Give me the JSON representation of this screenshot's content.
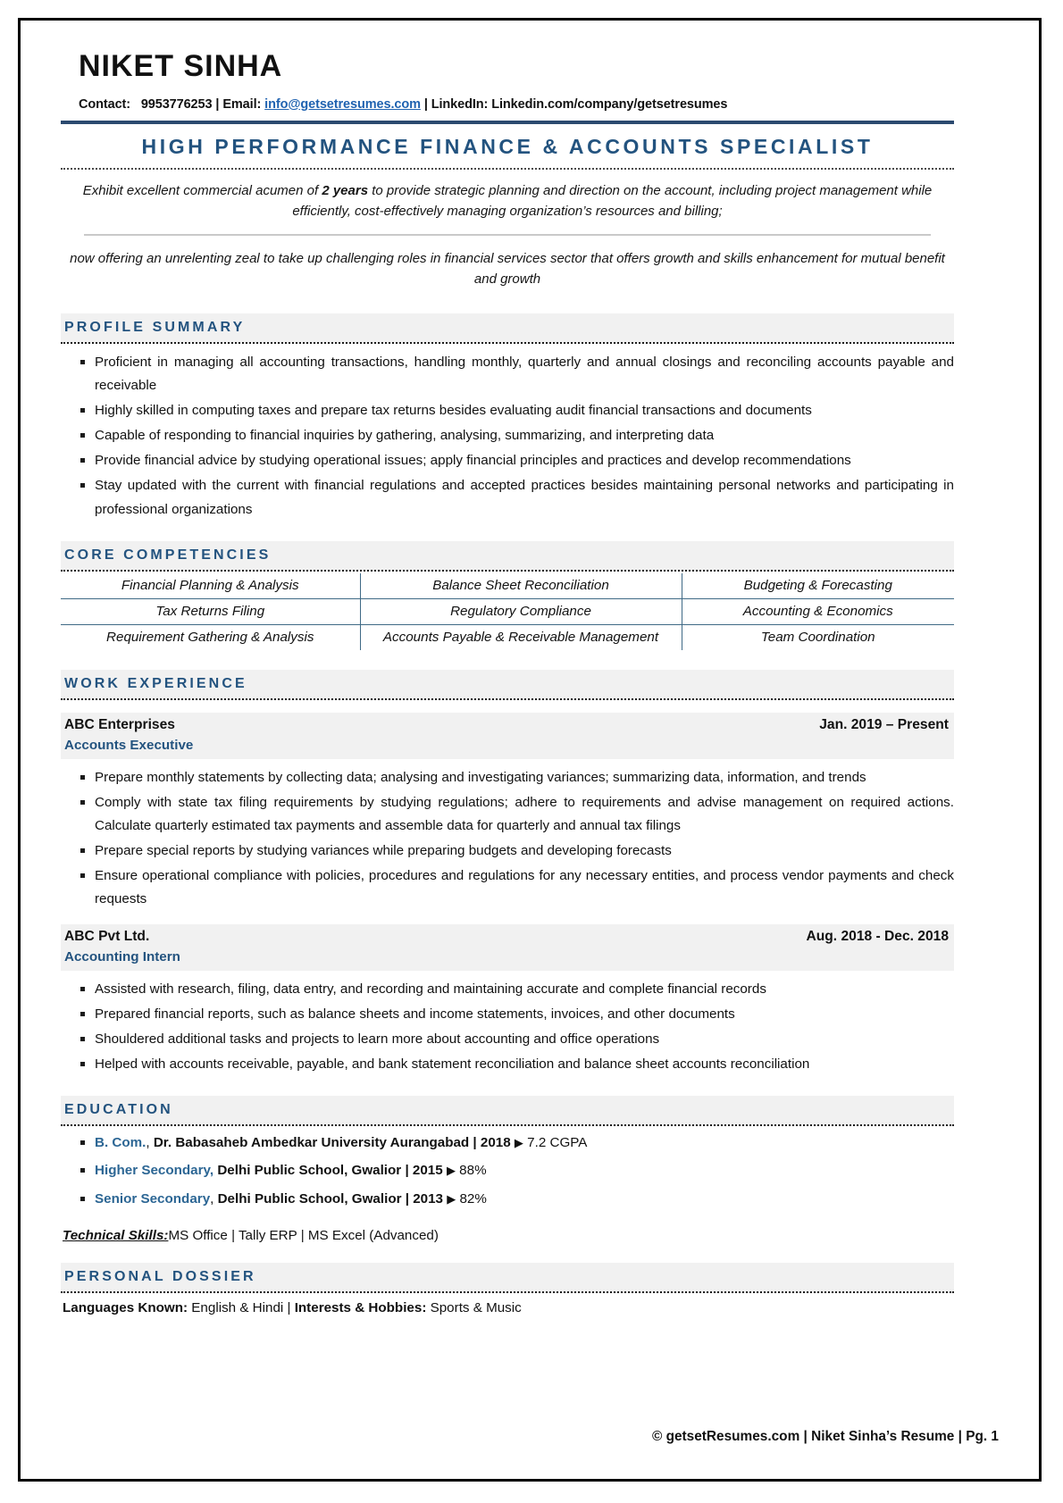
{
  "header": {
    "name": "NIKET SINHA",
    "contact_label": "Contact:",
    "phone": "9953776253",
    "sep1": "|",
    "email_label": "Email:",
    "email": "info@getsetresumes.com",
    "sep2": "|",
    "linkedin_label": "LinkedIn:",
    "linkedin": "Linkedin.com/company/getsetresumes"
  },
  "headline": "HIGH PERFORMANCE FINANCE & ACCOUNTS SPECIALIST",
  "objective": {
    "part1": "Exhibit excellent commercial acumen of ",
    "highlight": "2 years",
    "part2": " to provide strategic planning and direction on the account, including project management while efficiently, cost-effectively managing organization’s resources and billing;",
    "second": "now offering an unrelenting zeal to take up challenging roles in financial services sector that offers growth and skills enhancement for mutual benefit and growth"
  },
  "sections": {
    "profile_summary": {
      "title": "PROFILE SUMMARY",
      "items": [
        "Proficient in managing all accounting transactions, handling monthly, quarterly and annual closings and reconciling accounts payable and receivable",
        "Highly skilled in computing taxes and prepare tax returns besides evaluating audit financial transactions and documents",
        "Capable of responding to financial inquiries by gathering, analysing, summarizing, and interpreting data",
        "Provide financial advice by studying operational issues; apply financial principles and practices and develop recommendations",
        "Stay updated with the current with financial regulations and accepted practices besides maintaining personal networks and participating in professional organizations"
      ]
    },
    "core_competencies": {
      "title": "CORE COMPETENCIES",
      "rows": [
        [
          "Financial Planning & Analysis",
          "Balance Sheet Reconciliation",
          "Budgeting & Forecasting"
        ],
        [
          "Tax Returns Filing",
          "Regulatory Compliance",
          "Accounting & Economics"
        ],
        [
          "Requirement Gathering & Analysis",
          "Accounts Payable & Receivable Management",
          "Team Coordination"
        ]
      ]
    },
    "work_experience": {
      "title": "WORK EXPERIENCE",
      "jobs": [
        {
          "company": "ABC Enterprises",
          "dates": "Jan. 2019 – Present",
          "role": "Accounts Executive",
          "items": [
            "Prepare monthly statements by collecting data; analysing and investigating variances; summarizing data, information, and trends",
            "Comply with state tax filing requirements by studying regulations; adhere to requirements and advise management on required actions. Calculate quarterly estimated tax payments and assemble data for quarterly and annual tax filings",
            "Prepare special reports by studying variances while preparing budgets and developing forecasts",
            "Ensure operational compliance with policies, procedures and regulations for any necessary entities, and process vendor payments and check requests"
          ]
        },
        {
          "company": "ABC Pvt Ltd.",
          "dates": "Aug. 2018 - Dec. 2018",
          "role": "Accounting Intern",
          "items": [
            "Assisted with research, filing, data entry, and recording and maintaining accurate and complete financial records",
            "Prepared financial reports, such as balance sheets and income statements, invoices, and other documents",
            "Shouldered additional tasks and projects to learn more about accounting and office operations",
            "Helped with accounts receivable, payable, and bank statement reconciliation and balance sheet accounts reconciliation"
          ]
        }
      ]
    },
    "education": {
      "title": "EDUCATION",
      "arrow": "▶",
      "items": [
        {
          "degree": "B. Com.",
          "sep": ", ",
          "institution": "Dr. Babasaheb Ambedkar University Aurangabad | 2018",
          "score": "7.2 CGPA"
        },
        {
          "degree": "Higher Secondary,",
          "sep": " ",
          "institution": "Delhi Public School, Gwalior | 2015",
          "score": "88%"
        },
        {
          "degree": "Senior Secondary",
          "sep": ", ",
          "institution": "Delhi Public School, Gwalior | 2013",
          "score": "82%"
        }
      ],
      "tech_skills_label": "Technical Skills:",
      "tech_skills_value": "MS Office | Tally ERP | MS Excel (Advanced)"
    },
    "personal_dossier": {
      "title": "PERSONAL DOSSIER",
      "languages_label": "Languages Known:",
      "languages_value": "English & Hindi ",
      "pipe": "| ",
      "interests_label": "Interests & Hobbies:",
      "interests_value": "Sports & Music"
    }
  },
  "footer": "© getsetResumes.com | Niket Sinha’s Resume | Pg. 1",
  "colors": {
    "accent_blue": "#23537f",
    "link_blue": "#1f62b0",
    "band_gray": "#f1f1f1",
    "table_rule": "#3f6a86"
  }
}
